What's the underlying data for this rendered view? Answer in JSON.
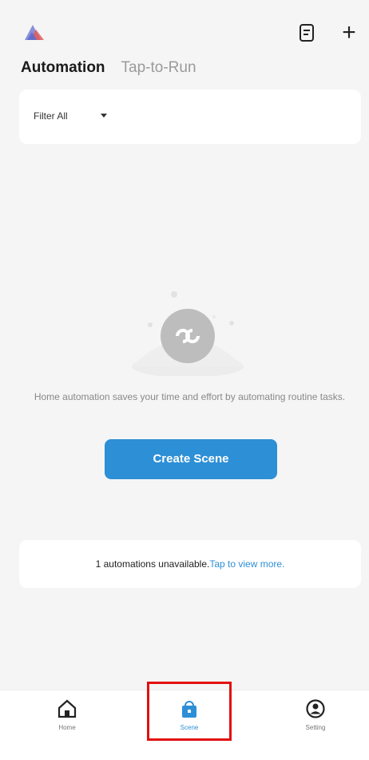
{
  "header": {
    "logo": "app-logo",
    "actions": [
      {
        "name": "document-icon"
      },
      {
        "name": "plus-icon",
        "glyph": "+"
      }
    ]
  },
  "tabs": [
    {
      "label": "Automation",
      "active": true
    },
    {
      "label": "Tap-to-Run",
      "active": false
    }
  ],
  "filter": {
    "label": "Filter All"
  },
  "empty_state": {
    "icon": "infinity-link-icon",
    "message": "Home automation saves your time and effort by automating routine tasks.",
    "button_label": "Create Scene"
  },
  "notice": {
    "text": "1 automations unavailable.",
    "link": "Tap to view more."
  },
  "bottom_nav": [
    {
      "label": "Home",
      "icon": "home-icon",
      "active": false
    },
    {
      "label": "Scene",
      "icon": "scene-icon",
      "active": true
    },
    {
      "label": "Setting",
      "icon": "user-icon",
      "active": false
    }
  ],
  "colors": {
    "accent": "#2d8fd6",
    "background": "#f5f5f5",
    "highlight": "#e21010"
  }
}
